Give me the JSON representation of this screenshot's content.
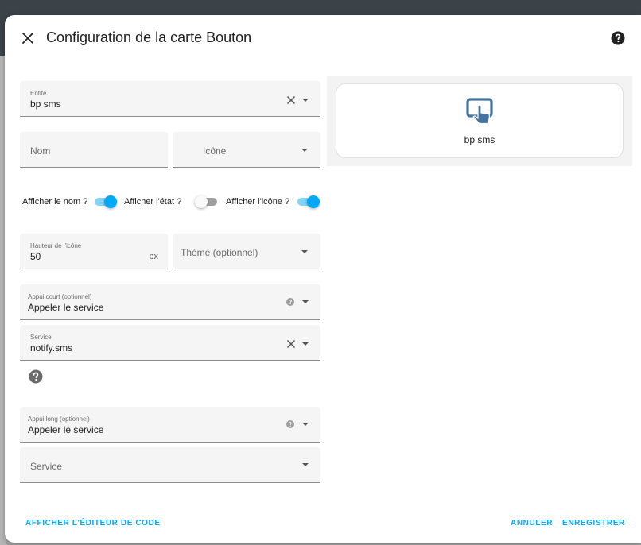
{
  "dialog": {
    "title": "Configuration de la carte Bouton"
  },
  "fields": {
    "entity": {
      "label": "Entité",
      "value": "bp sms"
    },
    "name": {
      "placeholder": "Nom"
    },
    "icon": {
      "placeholder": "Icône"
    },
    "icon_height": {
      "label": "Hauteur de l'icône",
      "value": "50",
      "suffix": "px"
    },
    "theme": {
      "placeholder": "Thème (optionnel)"
    },
    "tap_action": {
      "label": "Appui court (optionnel)",
      "value": "Appeler le service"
    },
    "tap_service": {
      "label": "Service",
      "value": "notify.sms"
    },
    "hold_action": {
      "label": "Appui long (optionnel)",
      "value": "Appeler le service"
    },
    "hold_service": {
      "placeholder": "Service"
    }
  },
  "toggles": {
    "show_name": {
      "label": "Afficher le nom ?",
      "on": true
    },
    "show_state": {
      "label": "Afficher l'état ?",
      "on": false
    },
    "show_icon": {
      "label": "Afficher l'icône ?",
      "on": true
    }
  },
  "preview": {
    "label": "bp sms",
    "icon": "gesture-tap-button-icon"
  },
  "footer": {
    "code_editor_label": "AFFICHER L'ÉDITEUR DE CODE",
    "cancel_label": "ANNULER",
    "save_label": "ENREGISTRER"
  },
  "colors": {
    "accent": "#03a9f4",
    "preview_icon": "#44739e",
    "toggle_off": "#9e9e9e"
  }
}
